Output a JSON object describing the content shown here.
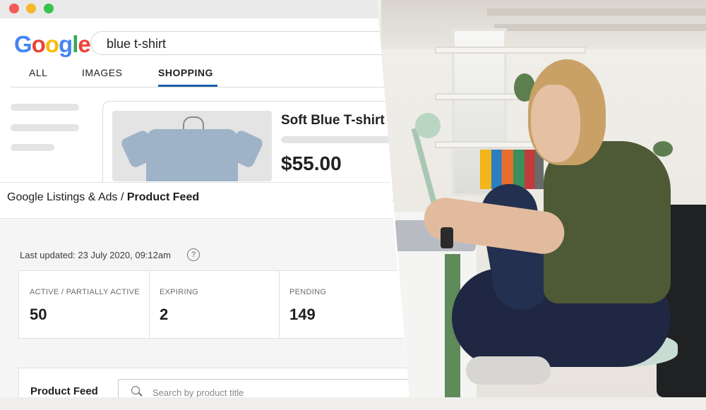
{
  "browser": {
    "logo_letters": [
      {
        "ch": "G",
        "color": "#4285F4"
      },
      {
        "ch": "o",
        "color": "#EA4335"
      },
      {
        "ch": "o",
        "color": "#FBBC05"
      },
      {
        "ch": "g",
        "color": "#4285F4"
      },
      {
        "ch": "l",
        "color": "#34A853"
      },
      {
        "ch": "e",
        "color": "#EA4335"
      }
    ],
    "search_query": "blue t-shirt",
    "tabs": [
      {
        "label": "ALL",
        "active": false
      },
      {
        "label": "IMAGES",
        "active": false
      },
      {
        "label": "SHOPPING",
        "active": true
      }
    ],
    "accent_color": "#1a5fa8",
    "product": {
      "title": "Soft Blue T-shirt",
      "price": "$55.00"
    }
  },
  "panel": {
    "breadcrumb_parent": "Google Listings & Ads / ",
    "breadcrumb_current": "Product Feed",
    "last_updated": "Last updated: 23 July 2020, 09:12am",
    "help_glyph": "?",
    "stats": [
      {
        "label": "ACTIVE / PARTIALLY ACTIVE",
        "value": "50"
      },
      {
        "label": "EXPIRING",
        "value": "2"
      },
      {
        "label": "PENDING",
        "value": "149"
      }
    ],
    "feed_title": "Product Feed",
    "search_placeholder": "Search by product title"
  }
}
